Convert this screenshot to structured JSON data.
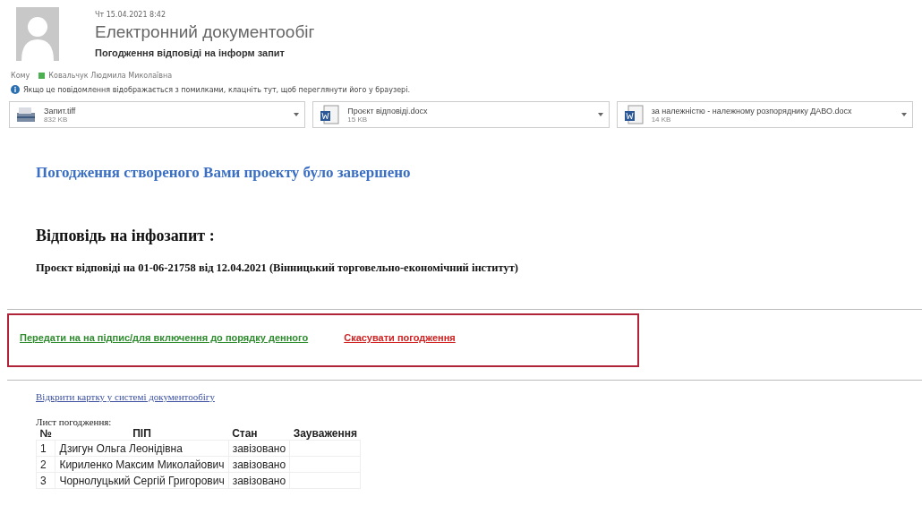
{
  "header": {
    "date": "Чт 15.04.2021 8:42",
    "sender": "Електронний документообіг",
    "subject": "Погодження відповіді на інформ запит",
    "to_label": "Кому",
    "recipient": "Ковальчук Людмила Миколаївна",
    "info": "Якщо це повідомлення відображається з помилками, клацніть тут, щоб переглянути його у браузері."
  },
  "attachments": [
    {
      "kind": "image",
      "name": "Запит.tiff",
      "size": "832 KB"
    },
    {
      "kind": "word",
      "name": "Проєкт відповіді.docx",
      "size": "15 KB"
    },
    {
      "kind": "word",
      "name": "за належністю - належному розпоряднику ДАВО.docx",
      "size": "14 KB"
    }
  ],
  "body": {
    "status_heading": "Погодження створеного Вами проекту було завершено",
    "section_heading": "Відповідь на інфозапит :",
    "project": "Проєкт відповіді на 01-06-21758 від 12.04.2021 (Вінницький торговельно-економічний інститут)",
    "actions": [
      {
        "label": "Передати на на підпис/для включення до порядку денного",
        "color": "#2e8b2e"
      },
      {
        "label": "Скасувати погодження",
        "color": "#d02020"
      }
    ],
    "open_link": "Відкрити картку у системі документообігу",
    "table_caption": "Лист погодження:",
    "table": {
      "columns": [
        "№",
        "ПІП",
        "Стан",
        "Зауваження"
      ],
      "rows": [
        [
          "1",
          "Дзигун Ольга Леонідівна",
          "завізовано",
          ""
        ],
        [
          "2",
          "Кириленко Максим Миколайович",
          "завізовано",
          ""
        ],
        [
          "3",
          "Чорнолуцький Сергій Григорович",
          "завізовано",
          ""
        ]
      ]
    }
  }
}
